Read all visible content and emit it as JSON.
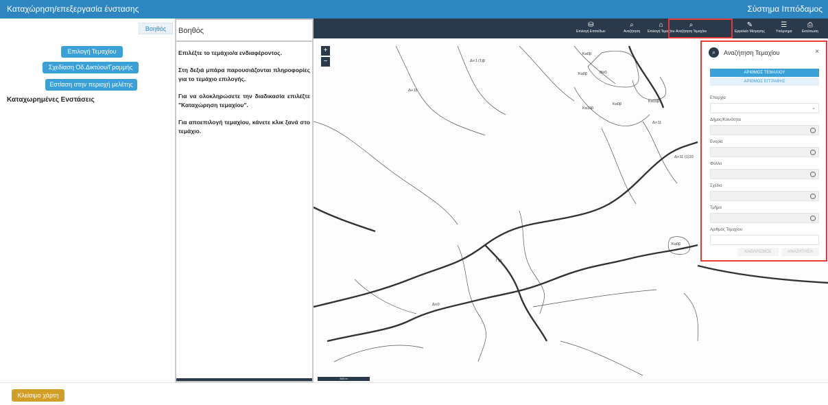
{
  "header": {
    "title": "Καταχώρηση/επεξεργασία ένστασης",
    "system": "Σύστημα Ιππόδαμος"
  },
  "left": {
    "help_tab": "Βοηθός",
    "buttons": [
      "Επιλογή Τεμαχίου",
      "Σχεδίαση Οδ.Δικτύου/Γραμμής",
      "Εστίαση στην περιοχή μελέτης"
    ],
    "registered_label": "Καταχωρημένες Ενστάσεις"
  },
  "helpbox": {
    "title": "Βοηθός",
    "paragraphs": [
      "Επιλέξτε το τεμάχιο/α ενδιαφέροντος.",
      "Στη δεξιά μπάρα παρουσιάζονται πληροφορίες για το τεμάχιο επιλογής.",
      "Για να ολοκληρώσετε την διαδικασία επιλέξτε \"Καταχώρηση τεμαχίου\".",
      "Για αποεπιλογή τεμαχίου, κάνετε κλικ ξανά στο τεμάχιο."
    ]
  },
  "map": {
    "toolbar": [
      {
        "icon": "layers-icon",
        "glyph": "⛁",
        "label": "Επιλογή Επιπέδων"
      },
      {
        "icon": "search-icon",
        "glyph": "⌕",
        "label": "Αναζήτηση"
      },
      {
        "icon": "select-parcel-icon",
        "glyph": "⌂",
        "label": "Επιλογή Τεμαχίου"
      },
      {
        "icon": "parcel-search-icon",
        "glyph": "⌕",
        "label": "Αναζήτηση Τεμαχίου"
      },
      {
        "icon": "ruler-icon",
        "glyph": "✎",
        "label": "Εργαλείο Μέτρησης"
      },
      {
        "icon": "legend-icon",
        "glyph": "☰",
        "label": "Υπόμνημα"
      },
      {
        "icon": "print-icon",
        "glyph": "⎙",
        "label": "Εκτύπωση"
      }
    ],
    "zoom_in": "+",
    "zoom_out": "−",
    "scale": "500 m",
    "labels": [
      "Δ∞1 (1)β",
      "Δ∞11",
      "Κα0β",
      "Κα0β",
      "Θα0",
      "Κα10β",
      "Κα0β",
      "Κα10β",
      "Δ∞11",
      "Δ∞11 (1)10",
      "Γγ1",
      "Δ∞0",
      "Κα0β"
    ]
  },
  "panel": {
    "title": "Αναζήτηση Τεμαχίου",
    "close": "×",
    "tab_active": "ΑΡΙΘΜΟΣ ΤΕΜΑΧΙΟΥ",
    "tab_inactive": "ΑΡΙΘΜΟΣ ΕΓΓΡΑΦΗΣ",
    "fields": [
      "Επαρχία",
      "Δήμος/Κοινότητα",
      "Ενορία",
      "Φύλλο",
      "Σχέδιο",
      "Τμήμα",
      "Αριθμός Τεμαχίου"
    ],
    "clear": "ΚΑΘΑΡΙΣΜΟΣ",
    "search": "ΑΝΑΖΗΤΗΣΗ"
  },
  "footer": {
    "close_map": "Κλείσιμο χάρτη"
  }
}
